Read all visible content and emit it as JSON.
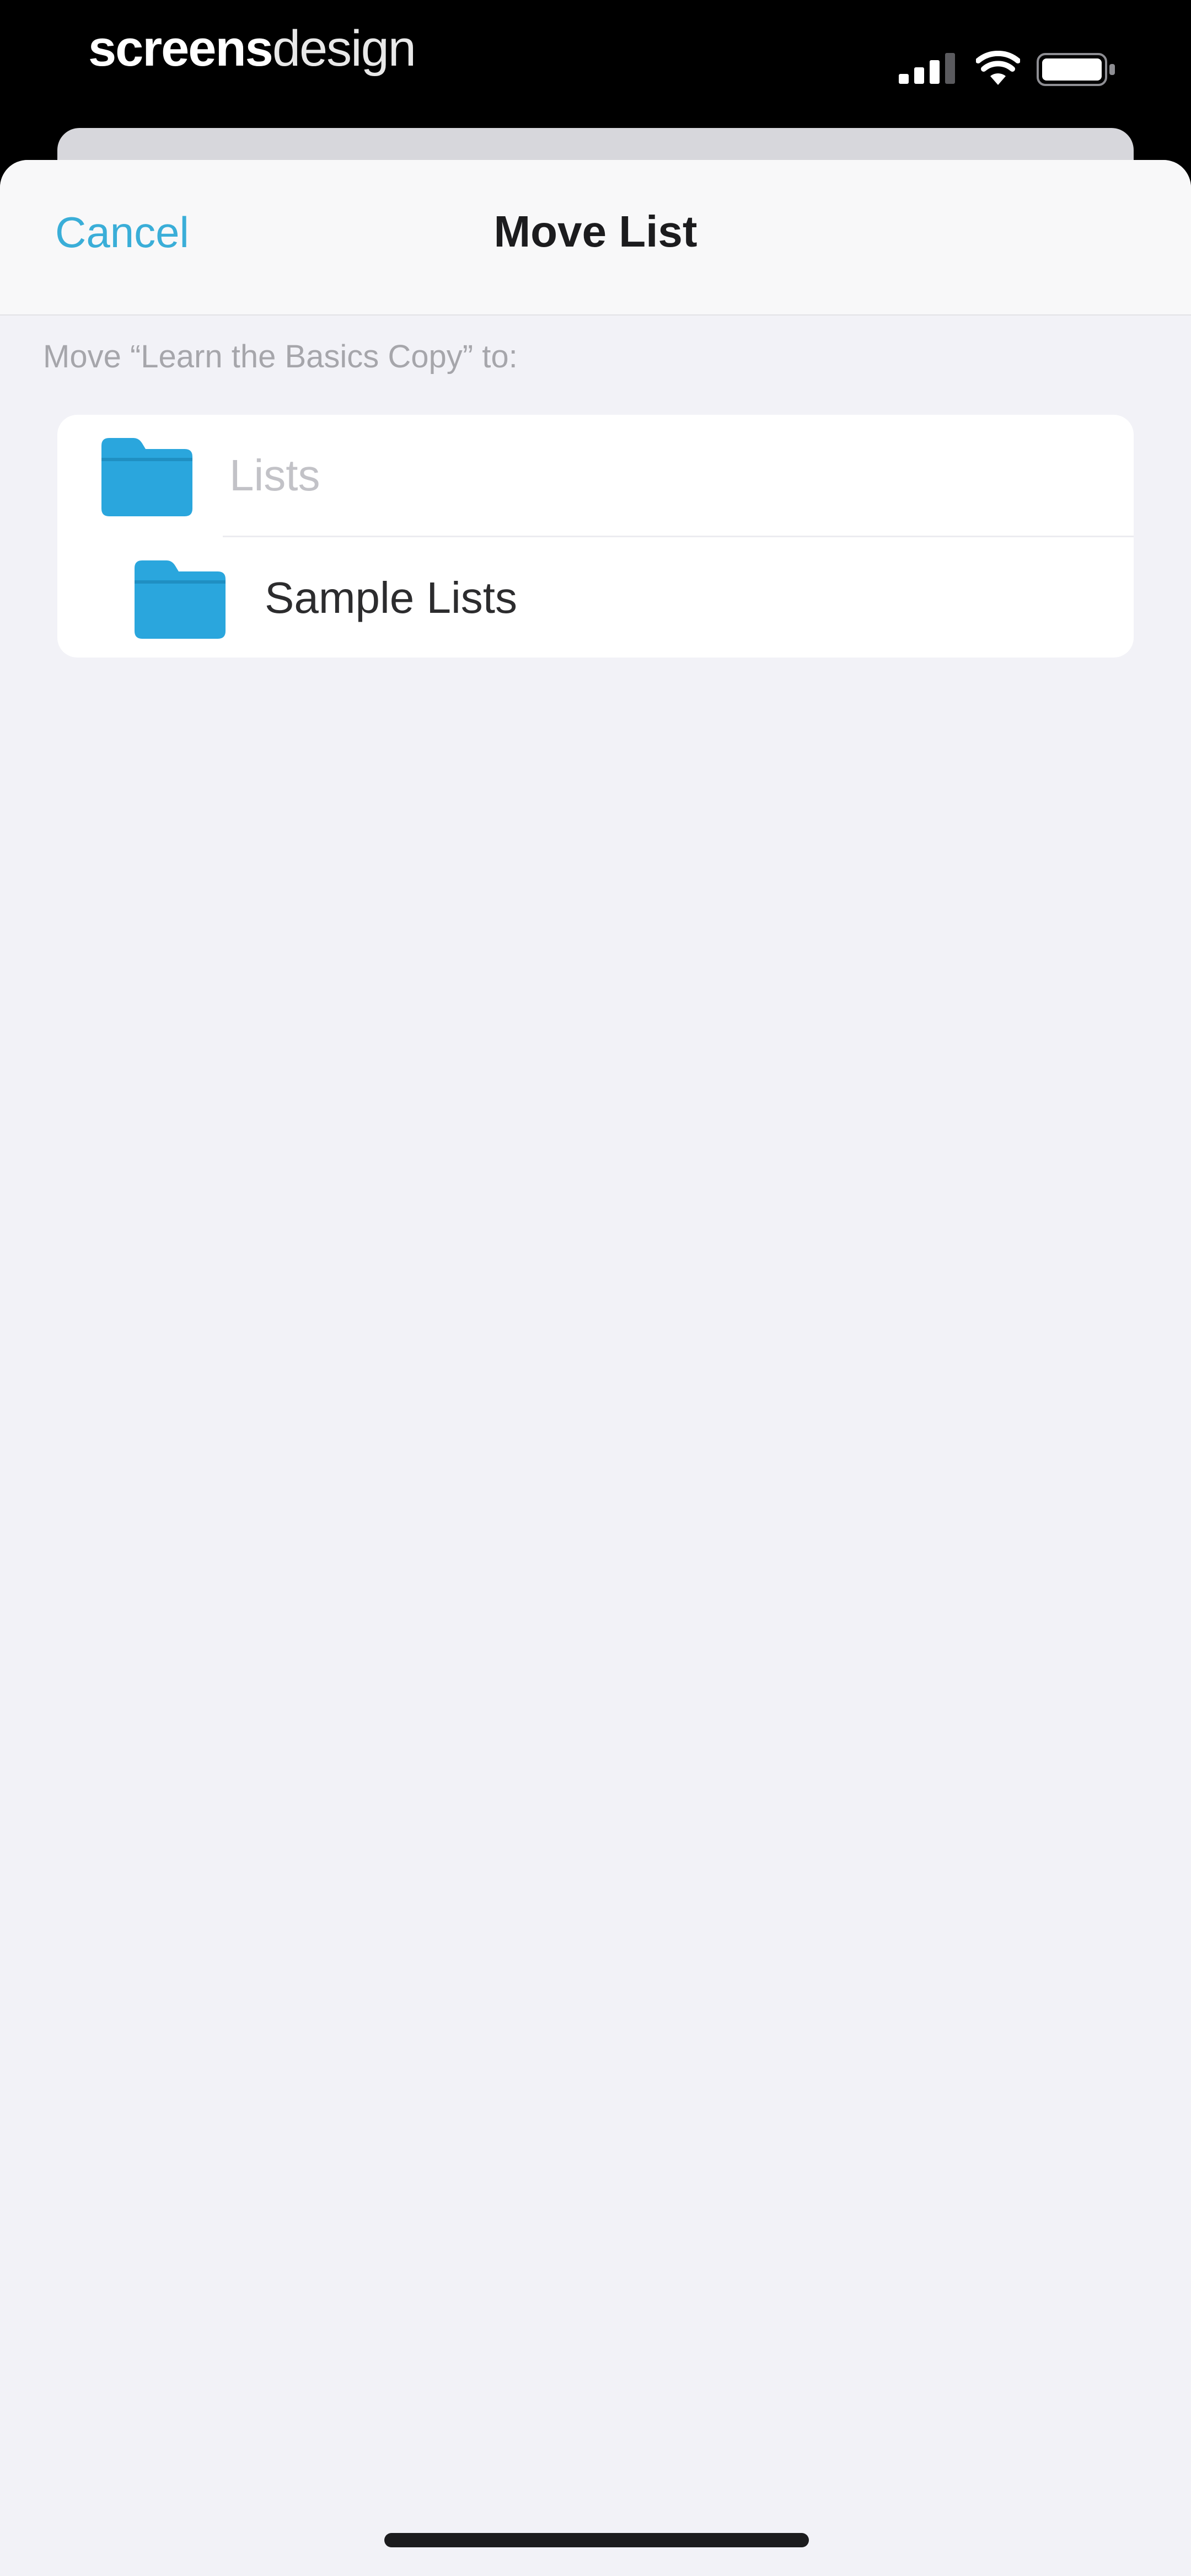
{
  "status_bar": {
    "brand_bold": "screens",
    "brand_light": "design",
    "icons": [
      "signal-icon",
      "wifi-icon",
      "battery-icon"
    ]
  },
  "nav": {
    "cancel_label": "Cancel",
    "title": "Move List"
  },
  "section_caption": "Move “Learn the Basics Copy” to:",
  "folders": [
    {
      "label": "Lists",
      "icon": "folder-icon",
      "disabled": true
    },
    {
      "label": "Sample Lists",
      "icon": "folder-icon",
      "disabled": false
    }
  ],
  "colors": {
    "accent": "#3aaed8",
    "folder": "#2aa6dd",
    "background": "#f2f2f7"
  }
}
